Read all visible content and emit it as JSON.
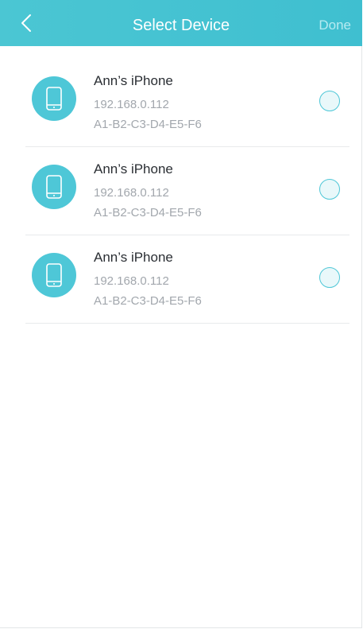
{
  "header": {
    "title": "Select Device",
    "done_label": "Done"
  },
  "devices": [
    {
      "name": "Ann’s iPhone",
      "ip": "192.168.0.112",
      "mac": "A1-B2-C3-D4-E5-F6",
      "selected": false
    },
    {
      "name": "Ann’s iPhone",
      "ip": "192.168.0.112",
      "mac": "A1-B2-C3-D4-E5-F6",
      "selected": false
    },
    {
      "name": "Ann’s iPhone",
      "ip": "192.168.0.112",
      "mac": "A1-B2-C3-D4-E5-F6",
      "selected": false
    }
  ],
  "icons": {
    "back": "chevron-left-icon",
    "device": "phone-icon",
    "select": "radio-button"
  },
  "colors": {
    "accent": "#4ec7d7",
    "header_bg": "#45c3d2",
    "done_disabled": "#b6ebf1",
    "primary_text": "#2a2e33",
    "secondary_text": "#a2a7ad"
  }
}
